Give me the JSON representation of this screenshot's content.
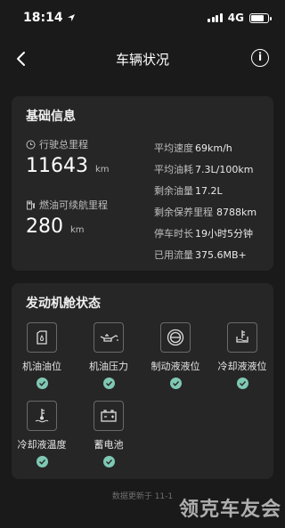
{
  "status_bar": {
    "time": "18:14",
    "network": "4G"
  },
  "nav": {
    "title": "车辆状况"
  },
  "basic_info": {
    "title": "基础信息",
    "total_mileage": {
      "label": "行驶总里程",
      "value": "11643",
      "unit": "km"
    },
    "fuel_range": {
      "label": "燃油可续航里程",
      "value": "280",
      "unit": "km"
    },
    "stats": [
      {
        "label": "平均速度",
        "value": "69km/h"
      },
      {
        "label": "平均油耗",
        "value": "7.3L/100km"
      },
      {
        "label": "剩余油量",
        "value": "17.2L"
      },
      {
        "label": "剩余保养里程",
        "value": "8788km"
      },
      {
        "label": "停车时长",
        "value": "19小时5分钟"
      },
      {
        "label": "已用流量",
        "value": "375.6MB+"
      }
    ]
  },
  "engine": {
    "title": "发动机舱状态",
    "items": [
      {
        "label": "机油油位",
        "icon": "oil-level-icon",
        "status": "ok"
      },
      {
        "label": "机油压力",
        "icon": "oil-pressure-icon",
        "status": "ok"
      },
      {
        "label": "制动液液位",
        "icon": "brake-fluid-icon",
        "status": "ok"
      },
      {
        "label": "冷却液液位",
        "icon": "coolant-level-icon",
        "status": "ok"
      },
      {
        "label": "冷却液温度",
        "icon": "coolant-temperature-icon",
        "status": "ok"
      },
      {
        "label": "蓄电池",
        "icon": "battery-icon",
        "status": "ok"
      }
    ]
  },
  "footer": {
    "update_note": "数据更新于 11-1"
  },
  "watermark": {
    "text": "领克车友会"
  },
  "colors": {
    "background": "#1a1a1a",
    "card": "#262626",
    "ok": "#7fc8b4"
  }
}
